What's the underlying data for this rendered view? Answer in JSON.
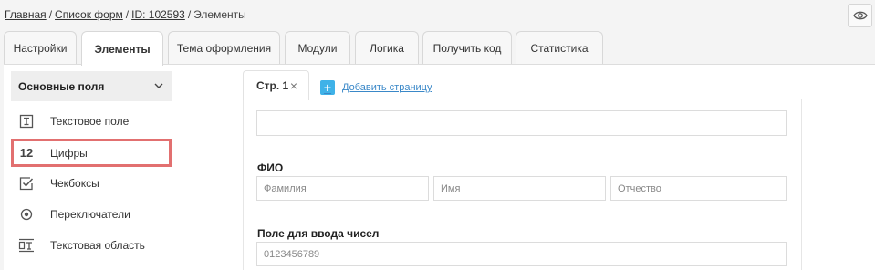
{
  "breadcrumb": {
    "home": "Главная",
    "forms": "Список форм",
    "id": "ID: 102593",
    "current": "Элементы",
    "sep": "/"
  },
  "tabs": [
    {
      "label": "Настройки",
      "active": false
    },
    {
      "label": "Элементы",
      "active": true
    },
    {
      "label": "Тема оформления",
      "active": false
    },
    {
      "label": "Модули",
      "active": false
    },
    {
      "label": "Логика",
      "active": false
    },
    {
      "label": "Получить код",
      "active": false
    },
    {
      "label": "Статистика",
      "active": false
    }
  ],
  "sidebar": {
    "section_title": "Основные поля",
    "items": [
      {
        "label": "Текстовое поле",
        "icon": "text-field-icon"
      },
      {
        "label": "Цифры",
        "icon_text": "12",
        "icon": "digits-icon",
        "highlighted": true
      },
      {
        "label": "Чекбоксы",
        "icon": "checkbox-icon"
      },
      {
        "label": "Переключатели",
        "icon": "radio-icon"
      },
      {
        "label": "Текстовая область",
        "icon": "textarea-icon"
      }
    ]
  },
  "editor": {
    "page_tab": "Стр. 1",
    "add_page": "Добавить страницу",
    "fio_label": "ФИО",
    "fio_fields": [
      "Фамилия",
      "Имя",
      "Отчество"
    ],
    "number_label": "Поле для ввода чисел",
    "number_placeholder": "0123456789"
  },
  "colors": {
    "highlight": "#e27070",
    "accent": "#3fb2e8",
    "link": "#3a88c8"
  }
}
